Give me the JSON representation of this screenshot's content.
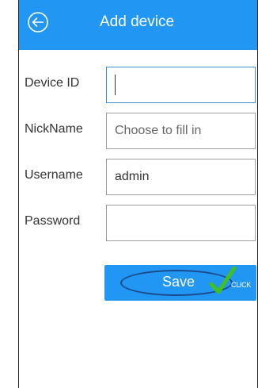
{
  "header": {
    "title": "Add device",
    "back_icon": "back-arrow-circle-icon"
  },
  "form": {
    "device_id": {
      "label": "Device ID",
      "value": "",
      "placeholder": ""
    },
    "nickname": {
      "label": "NickName",
      "value": "",
      "placeholder": "Choose to fill in"
    },
    "username": {
      "label": "Username",
      "value": "admin",
      "placeholder": ""
    },
    "password": {
      "label": "Password",
      "value": "",
      "placeholder": ""
    }
  },
  "save_button": {
    "label": "Save",
    "click_annotation": "CLICK",
    "check_icon": "check-mark-icon"
  },
  "colors": {
    "accent": "#2196f3",
    "focused_border": "#3a8fd6",
    "check": "#43c01f"
  }
}
